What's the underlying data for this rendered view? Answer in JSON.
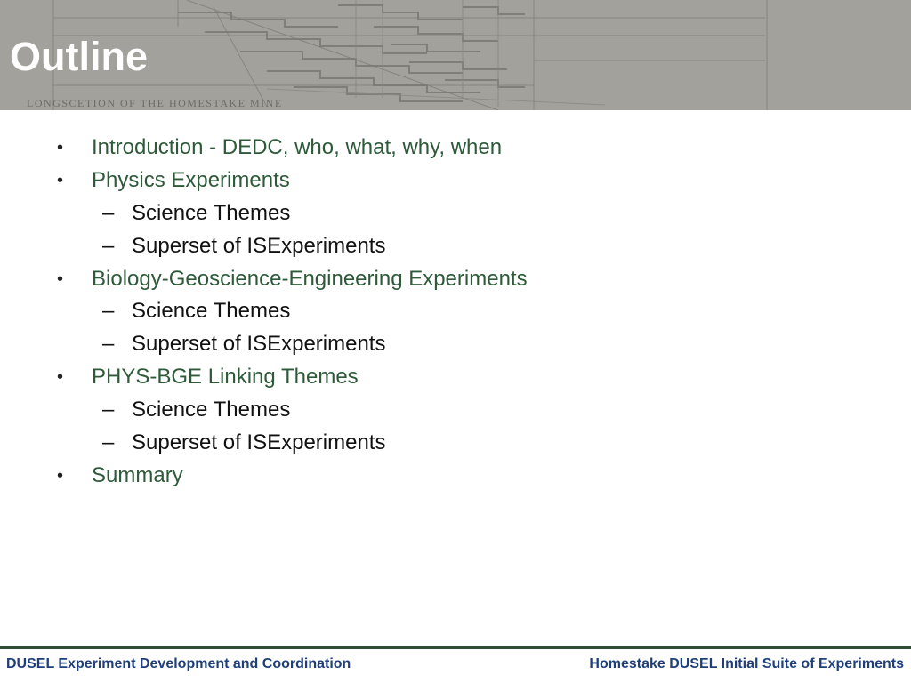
{
  "slide": {
    "title": "Outline",
    "header_caption": "LONGSCETION OF THE HOMESTAKE MINE",
    "header_image": "homestake-mine-longsection-drawing",
    "colors": {
      "header_bg": "#a3a19c",
      "title": "#ffffff",
      "level1_text": "#2e5a3a",
      "level2_text": "#111111",
      "footer_rule": "#2f4d33",
      "footer_text": "#1f3f7a"
    },
    "outline": [
      {
        "level": 1,
        "marker": "•",
        "text": "Introduction  - DEDC, who, what, why, when"
      },
      {
        "level": 1,
        "marker": "•",
        "text": "Physics Experiments"
      },
      {
        "level": 2,
        "marker": "–",
        "text": "Science Themes"
      },
      {
        "level": 2,
        "marker": "–",
        "text": "Superset of ISExperiments"
      },
      {
        "level": 1,
        "marker": "•",
        "text": "Biology-Geoscience-Engineering Experiments"
      },
      {
        "level": 2,
        "marker": "–",
        "text": "Science Themes"
      },
      {
        "level": 2,
        "marker": "–",
        "text": "Superset of ISExperiments"
      },
      {
        "level": 1,
        "marker": "•",
        "text": "PHYS-BGE Linking Themes"
      },
      {
        "level": 2,
        "marker": "–",
        "text": "Science Themes"
      },
      {
        "level": 2,
        "marker": "–",
        "text": "Superset of ISExperiments"
      },
      {
        "level": 1,
        "marker": "•",
        "text": "Summary"
      }
    ],
    "footer": {
      "left": "DUSEL Experiment Development and Coordination",
      "right": "Homestake DUSEL Initial Suite of Experiments"
    }
  }
}
